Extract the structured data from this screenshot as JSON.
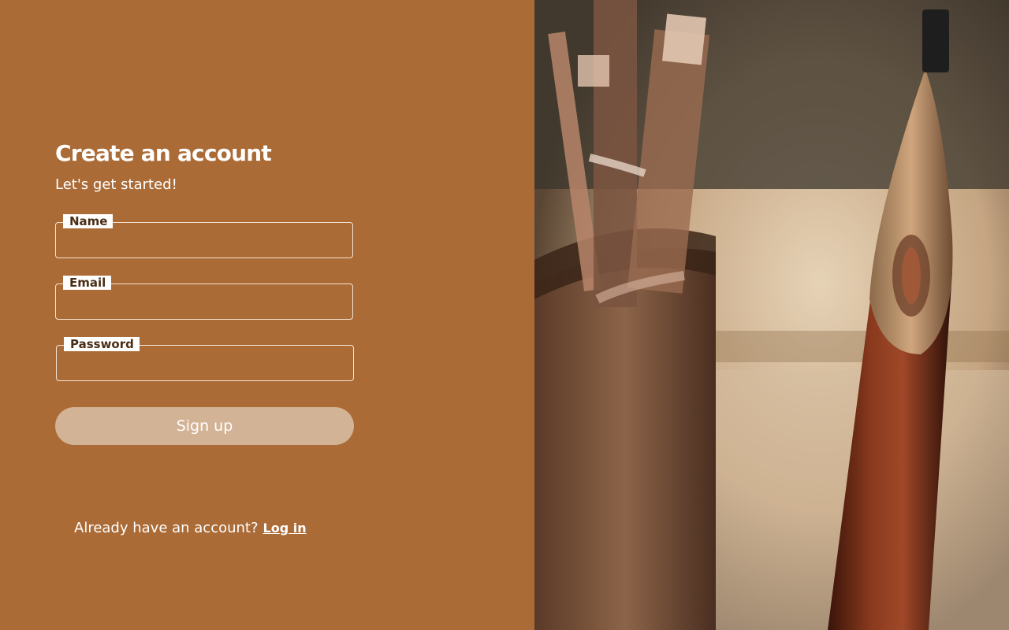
{
  "form": {
    "title": "Create an account",
    "subtitle": "Let's get started!",
    "fields": [
      {
        "label": "Name",
        "value": "",
        "placeholder": ""
      },
      {
        "label": "Email",
        "value": "",
        "placeholder": ""
      },
      {
        "label": "Password",
        "value": "",
        "placeholder": ""
      }
    ],
    "submit_label": "Sign up"
  },
  "footer": {
    "prompt": "Already have an account?",
    "login_link": "Log in"
  },
  "colors": {
    "panel_background": "#ab6b36",
    "button_background": "#d3b396",
    "label_text": "#4a2e16",
    "text": "#ffffff"
  },
  "image": {
    "subject": "bamboo-pen-and-pen-holder-photo"
  }
}
